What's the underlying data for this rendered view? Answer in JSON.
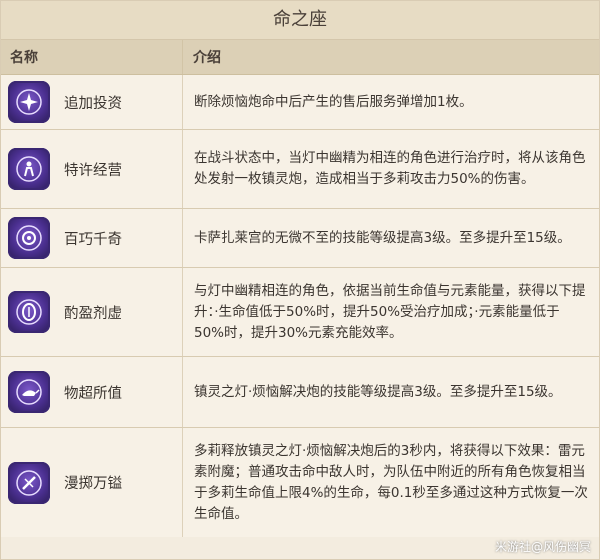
{
  "title": "命之座",
  "headers": {
    "name": "名称",
    "desc": "介绍"
  },
  "rows": [
    {
      "name": "追加投资",
      "icon": "constellation-sparkle-icon",
      "desc": "断除烦恼炮命中后产生的售后服务弹增加1枚。"
    },
    {
      "name": "特许经营",
      "icon": "constellation-figure-icon",
      "desc": "在战斗状态中，当灯中幽精为相连的角色进行治疗时，将从该角色处发射一枚镇灵炮，造成相当于多莉攻击力50%的伤害。"
    },
    {
      "name": "百巧千奇",
      "icon": "constellation-orb-icon",
      "desc": "卡萨扎莱宫的无微不至的技能等级提高3级。至多提升至15级。"
    },
    {
      "name": "酌盈剂虚",
      "icon": "constellation-coin-icon",
      "desc": "与灯中幽精相连的角色，依据当前生命值与元素能量，获得以下提升：·生命值低于50%时，提升50%受治疗加成；·元素能量低于50%时，提升30%元素充能效率。"
    },
    {
      "name": "物超所值",
      "icon": "constellation-lamp-icon",
      "desc": "镇灵之灯·烦恼解决炮的技能等级提高3级。至多提升至15级。"
    },
    {
      "name": "漫掷万镒",
      "icon": "constellation-blade-icon",
      "desc": "多莉释放镇灵之灯·烦恼解决炮后的3秒内，将获得以下效果：雷元素附魔；普通攻击命中敌人时，为队伍中附近的所有角色恢复相当于多莉生命值上限4%的生命，每0.1秒至多通过这种方式恢复一次生命值。"
    }
  ],
  "watermark": "米游社@风伤幽冥"
}
